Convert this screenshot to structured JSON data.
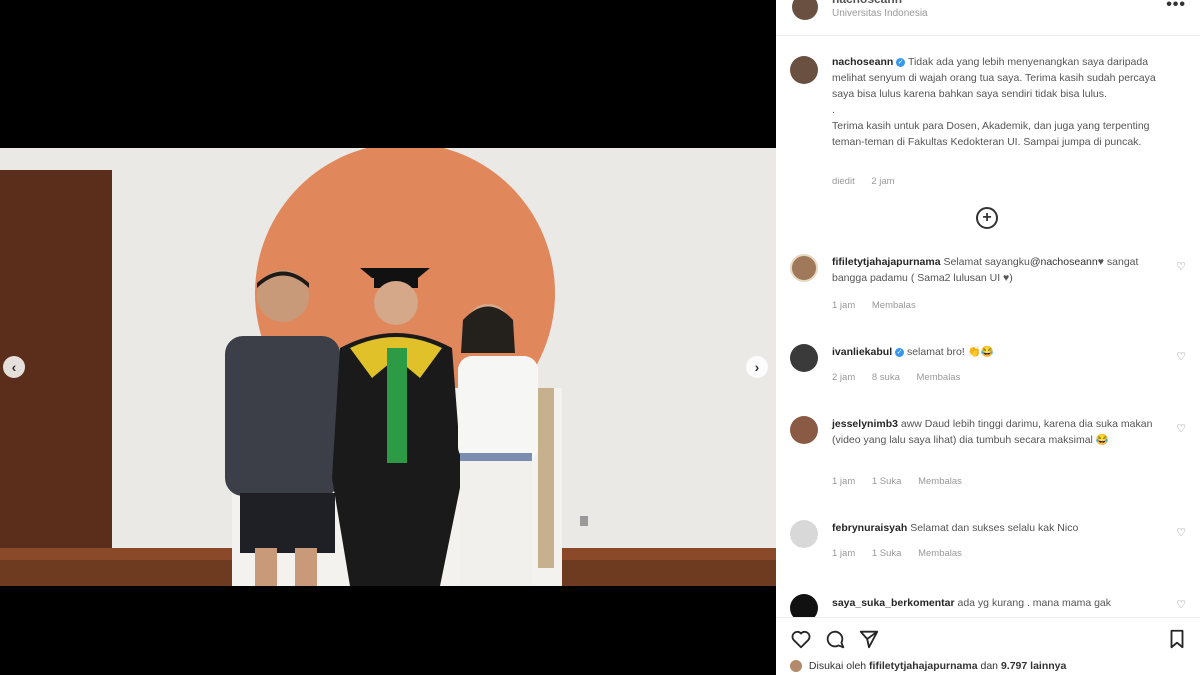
{
  "header": {
    "username": "nachoseann",
    "location": "Universitas Indonesia",
    "more_label": "•••"
  },
  "caption": {
    "username": "nachoseann",
    "line1": "Tidak ada yang lebih menyenangkan saya daripada melihat senyum di wajah orang tua saya. Terima kasih sudah percaya saya bisa lulus karena bahkan saya sendiri tidak bisa lulus.",
    "dot": ".",
    "line2": "Terima kasih untuk para Dosen, Akademik, dan juga yang terpenting teman-teman di Fakultas Kedokteran UI. Sampai jumpa di puncak.",
    "edited": "diedit",
    "time": "2 jam"
  },
  "load_more_label": "+",
  "comments": [
    {
      "username": "fifiletytjahajapurnama",
      "text_before": "Selamat sayangku",
      "mention": "@nachoseann",
      "text_after": "♥ sangat bangga padamu ( Sama2 lulusan UI ♥)",
      "time": "1 jam",
      "likes": "",
      "reply": "Membalas",
      "avatar_color": "#a0785a"
    },
    {
      "username": "ivanliekabul",
      "text_before": "selamat bro! 👏😂",
      "mention": "",
      "text_after": "",
      "time": "2 jam",
      "likes": "8 suka",
      "reply": "Membalas",
      "avatar_color": "#3a3a3a"
    },
    {
      "username": "jesselynimb3",
      "text_before": "aww Daud lebih tinggi darimu, karena dia suka makan (video yang lalu saya lihat) dia tumbuh secara maksimal 😂",
      "mention": "",
      "text_after": "",
      "time": "1 jam",
      "likes": "1 Suka",
      "reply": "Membalas",
      "avatar_color": "#8a5a44"
    },
    {
      "username": "febrynuraisyah",
      "text_before": "Selamat dan sukses selalu kak Nico",
      "mention": "",
      "text_after": "",
      "time": "1 jam",
      "likes": "1 Suka",
      "reply": "Membalas",
      "avatar_color": "#c8c8c8"
    },
    {
      "username": "saya_suka_berkomentar",
      "text_before": "ada yg kurang . mana mama gak",
      "mention": "",
      "text_after": "",
      "time": "",
      "likes": "",
      "reply": "",
      "avatar_color": "#111111"
    }
  ],
  "likes_line": {
    "prefix": "Disukai oleh",
    "user": "fifiletytjahajapurnama",
    "middle": "dan",
    "count": "9.797",
    "suffix": "lainnya"
  },
  "icons": {
    "like": "heart-icon",
    "comment": "comment-icon",
    "share": "send-icon",
    "save": "bookmark-icon"
  }
}
